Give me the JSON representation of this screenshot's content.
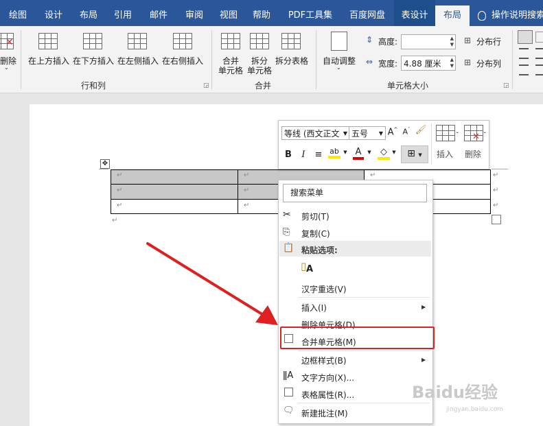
{
  "tabs": {
    "draw": "绘图",
    "design": "设计",
    "layout_doc": "布局",
    "references": "引用",
    "mailings": "邮件",
    "review": "审阅",
    "view": "视图",
    "help": "帮助",
    "pdf": "PDF工具集",
    "baidu": "百度网盘",
    "table_design": "表设计",
    "table_layout": "布局",
    "tell_me": "操作说明搜索"
  },
  "ribbon": {
    "delete": "删除",
    "insert_above": "在上方插入",
    "insert_below": "在下方插入",
    "insert_left": "在左侧插入",
    "insert_right": "在右侧插入",
    "group_rows_cols": "行和列",
    "merge_cells_1": "合并",
    "merge_cells_2": "单元格",
    "split_cells_1": "拆分",
    "split_cells_2": "单元格",
    "split_table": "拆分表格",
    "group_merge": "合并",
    "autofit": "自动调整",
    "height_label": "高度:",
    "height_value": "",
    "width_label": "宽度:",
    "width_value": "4.88 厘米",
    "distribute_rows": "分布行",
    "distribute_cols": "分布列",
    "group_cell_size": "单元格大小"
  },
  "mini_toolbar": {
    "font": "等线 (西文正文",
    "size": "五号",
    "bold": "B",
    "italic": "I",
    "insert": "插入",
    "delete": "删除"
  },
  "context_menu": {
    "search": "搜索菜单",
    "cut": "剪切(T)",
    "copy": "复制(C)",
    "paste_options": "粘贴选项:",
    "hanzi_reselect": "汉字重选(V)",
    "insert": "插入(I)",
    "delete_cells": "删除单元格(D)...",
    "merge_cells": "合并单元格(M)",
    "border_styles": "边框样式(B)",
    "text_direction": "文字方向(X)...",
    "table_properties": "表格属性(R)...",
    "new_comment": "新建批注(M)"
  },
  "watermark": {
    "brand": "Baidu经验",
    "url": "jingyan.baidu.com"
  },
  "colors": {
    "ribbon_blue": "#2b579a",
    "highlight_red": "#e02020",
    "selected_cell": "#c8c8c8"
  }
}
